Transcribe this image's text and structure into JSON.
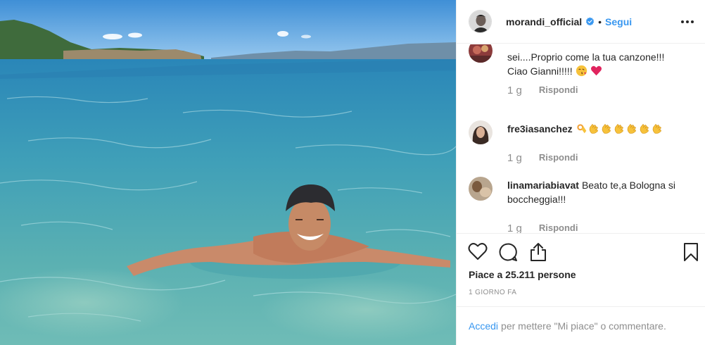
{
  "post": {
    "photo_icon": "photo-swimmer-sea"
  },
  "header": {
    "username": "morandi_official",
    "separator": "•",
    "follow_label": "Segui",
    "verified_icon": "verified-badge-icon",
    "more_icon": "more-options-icon"
  },
  "comments": [
    {
      "text_line1": "sei....Proprio come la tua canzone!!!",
      "text_line2": "Ciao Gianni!!!!!",
      "emoji": [
        "kiss-face",
        "red-heart"
      ],
      "time": "1 g",
      "reply_label": "Rispondi"
    },
    {
      "username": "fre3iasanchez",
      "text": "",
      "emoji": [
        "ok-hand",
        "clap",
        "clap",
        "clap",
        "clap",
        "clap",
        "clap"
      ],
      "time": "1 g",
      "reply_label": "Rispondi"
    },
    {
      "username": "linamariabiavat",
      "text": "Beato te,a Bologna si boccheggia!!!",
      "time": "1 g",
      "reply_label": "Rispondi"
    }
  ],
  "actions": {
    "like_icon": "heart-icon",
    "comment_icon": "comment-icon",
    "share_icon": "share-icon",
    "save_icon": "bookmark-icon",
    "likes_text": "Piace a 25.211 persone",
    "timestamp": "1 giorno fa"
  },
  "footer": {
    "login_label": "Accedi",
    "text": "per mettere \"Mi piace\" o commentare."
  },
  "colors": {
    "link": "#3897f0",
    "text": "#262626",
    "muted": "#8e8e8e",
    "border": "#efefef",
    "heart_red": "#e0245e"
  }
}
